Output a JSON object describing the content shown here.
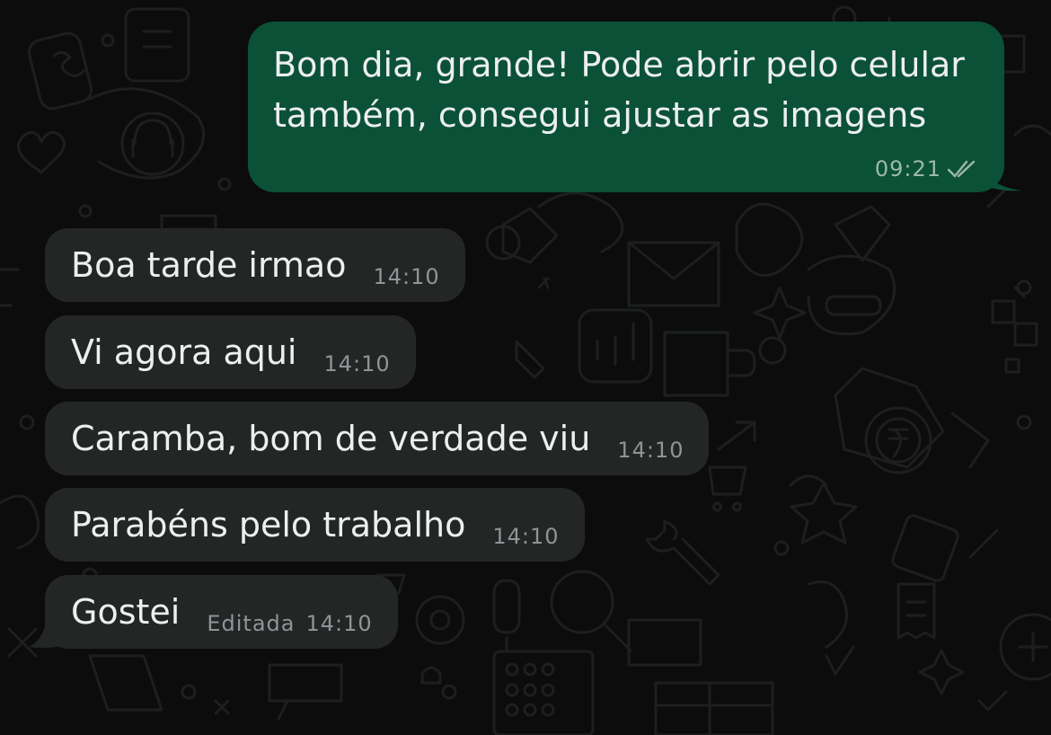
{
  "outgoing": {
    "text": "Bom dia, grande! Pode abrir pelo celular\ntambém, consegui ajustar as imagens",
    "time": "09:21",
    "status_icon": "double-check-icon"
  },
  "incoming": [
    {
      "text": "Boa tarde irmao",
      "time": "14:10"
    },
    {
      "text": "Vi agora aqui",
      "time": "14:10"
    },
    {
      "text": "Caramba, bom de verdade viu",
      "time": "14:10"
    },
    {
      "text": "Parabéns pelo trabalho",
      "time": "14:10"
    },
    {
      "text": "Gostei",
      "time": "14:10",
      "edited_label": "Editada"
    }
  ],
  "colors": {
    "background": "#0c0c0c",
    "outgoing_bubble": "#0b5137",
    "incoming_bubble": "#242626",
    "text": "#eceff0",
    "meta_text": "#8d9597"
  }
}
